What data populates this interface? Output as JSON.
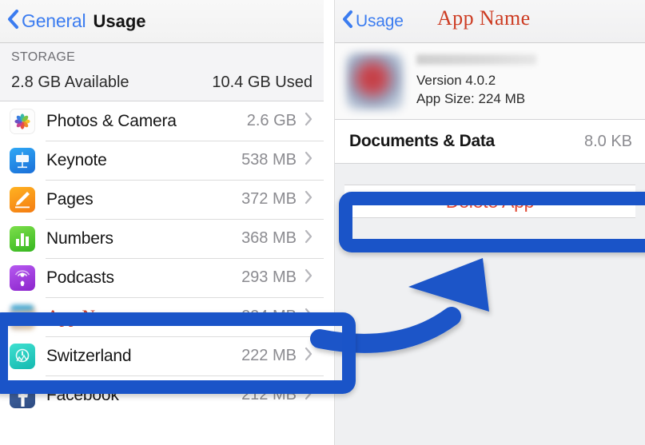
{
  "left_panel": {
    "nav": {
      "back_label": "General",
      "back_icon": "chevron-left-icon",
      "title": "Usage"
    },
    "storage": {
      "section_title": "STORAGE",
      "available": "2.8 GB Available",
      "used": "10.4 GB Used"
    },
    "apps": [
      {
        "name": "Photos & Camera",
        "size": "2.6 GB",
        "icon": "photos-app-icon"
      },
      {
        "name": "Keynote",
        "size": "538 MB",
        "icon": "keynote-app-icon"
      },
      {
        "name": "Pages",
        "size": "372 MB",
        "icon": "pages-app-icon"
      },
      {
        "name": "Numbers",
        "size": "368 MB",
        "icon": "numbers-app-icon"
      },
      {
        "name": "Podcasts",
        "size": "293 MB",
        "icon": "podcasts-app-icon"
      },
      {
        "name": "App Name",
        "size": "224 MB",
        "icon": "blurred-app-icon"
      },
      {
        "name": "Switzerland",
        "size": "222 MB",
        "icon": "switzerland-app-icon"
      },
      {
        "name": "Facebook",
        "size": "212 MB",
        "icon": "facebook-app-icon"
      }
    ]
  },
  "right_panel": {
    "nav": {
      "back_label": "Usage",
      "back_icon": "chevron-left-icon",
      "title": "App Name"
    },
    "app_info": {
      "version": "Version 4.0.2",
      "app_size": "App Size: 224 MB"
    },
    "documents": {
      "label": "Documents & Data",
      "value": "8.0 KB"
    },
    "delete_button_label": "Delete App"
  },
  "annotation": {
    "highlight_color": "#1a54c8",
    "arrow_color": "#1a54c8",
    "red_text_color": "#cd3c23",
    "delete_text_color": "#e2452f",
    "link_color": "#3b7cf0"
  }
}
